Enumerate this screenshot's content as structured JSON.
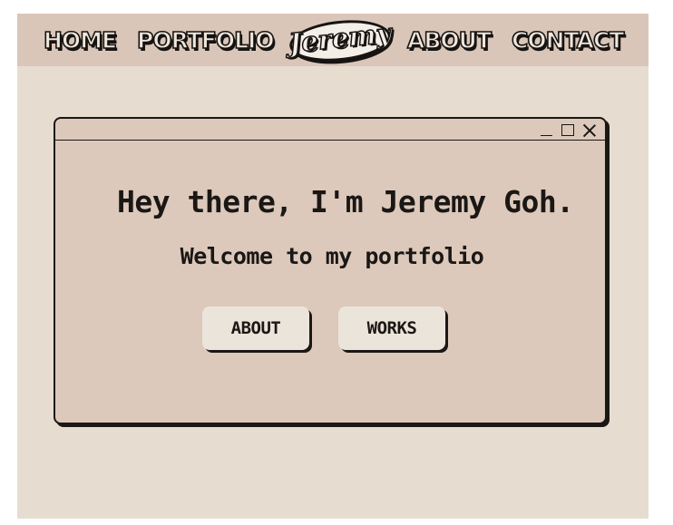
{
  "nav": {
    "home": "HOME",
    "portfolio": "PORTFOLIO",
    "logo": "Jeremy",
    "about": "ABOUT",
    "contact": "CONTACT"
  },
  "window": {
    "controls": [
      "minimize-icon",
      "maximize-icon",
      "close-icon"
    ],
    "headline": "Hey there, I'm Jeremy Goh.",
    "subline": "Welcome to my portfolio",
    "buttons": {
      "about": "ABOUT",
      "works": "WORKS"
    }
  },
  "colors": {
    "page_background": "#e6ddd0",
    "navbar_background": "#dac6b8",
    "window_background": "#dcc9bb",
    "button_background": "#ebe4da",
    "ink": "#1a1715"
  }
}
